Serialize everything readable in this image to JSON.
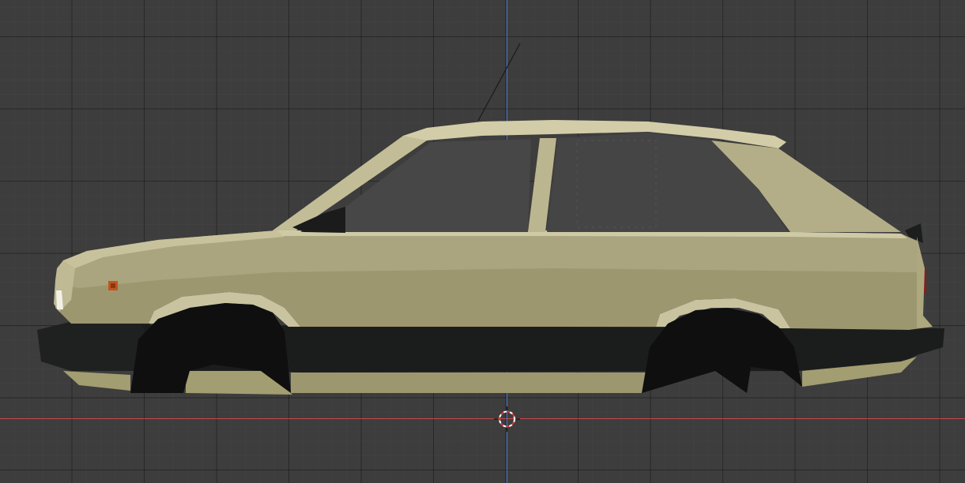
{
  "viewport": {
    "view": "side-orthographic",
    "background_color": "#3d3d3d",
    "grid_color": "#2a2a2a",
    "x_axis_color": "#c8464b",
    "z_axis_color": "#4a7bd6"
  },
  "object": {
    "type": "car-body-mesh",
    "icon": "car-icon",
    "body_color": "#a59f78",
    "trim_color": "#1c1e1d",
    "glass_color": "#454545",
    "indicator_color": "#c0551f",
    "tail_light_color": "#8a1c1c"
  },
  "cursor": {
    "icon": "3d-cursor-icon",
    "colors": [
      "#ffffff",
      "#d9363b"
    ]
  }
}
